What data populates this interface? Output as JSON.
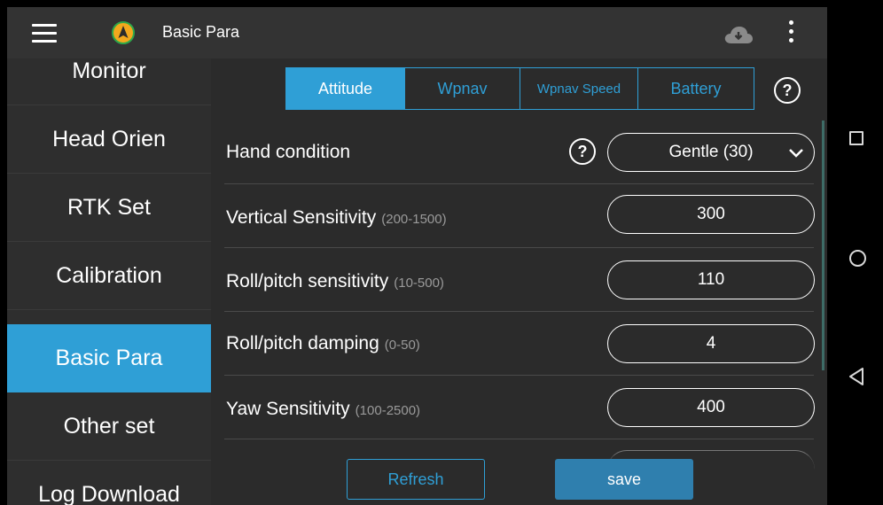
{
  "header": {
    "title": "Basic Para",
    "logo_icon": "compass-logo-icon",
    "cloud_icon": "cloud-download-icon",
    "menu_icon": "hamburger-menu-icon",
    "more_icon": "more-vertical-icon"
  },
  "sidebar": {
    "items": [
      {
        "label": "Monitor"
      },
      {
        "label": "Head Orien"
      },
      {
        "label": "RTK Set"
      },
      {
        "label": "Calibration"
      },
      {
        "label": "Basic Para",
        "active": true
      },
      {
        "label": "Other set"
      },
      {
        "label": "Log Download"
      }
    ]
  },
  "tabs": [
    {
      "label": "Attitude",
      "active": true
    },
    {
      "label": "Wpnav"
    },
    {
      "label": "Wpnav Speed"
    },
    {
      "label": "Battery"
    }
  ],
  "help_symbol": "?",
  "params": [
    {
      "label": "Hand condition",
      "range": "",
      "value": "Gentle (30)",
      "type": "select"
    },
    {
      "label": "Vertical Sensitivity",
      "range": "(200-1500)",
      "value": "300"
    },
    {
      "label": "Roll/pitch sensitivity",
      "range": "(10-500)",
      "value": "110"
    },
    {
      "label": "Roll/pitch damping",
      "range": "(0-50)",
      "value": "4"
    },
    {
      "label": "Yaw Sensitivity",
      "range": "(100-2500)",
      "value": "400"
    }
  ],
  "actions": {
    "refresh_label": "Refresh",
    "save_label": "save"
  },
  "colors": {
    "accent": "#2f9fd6",
    "background": "#2b2b2b",
    "topbar": "#333333",
    "save": "#2f7fae"
  }
}
